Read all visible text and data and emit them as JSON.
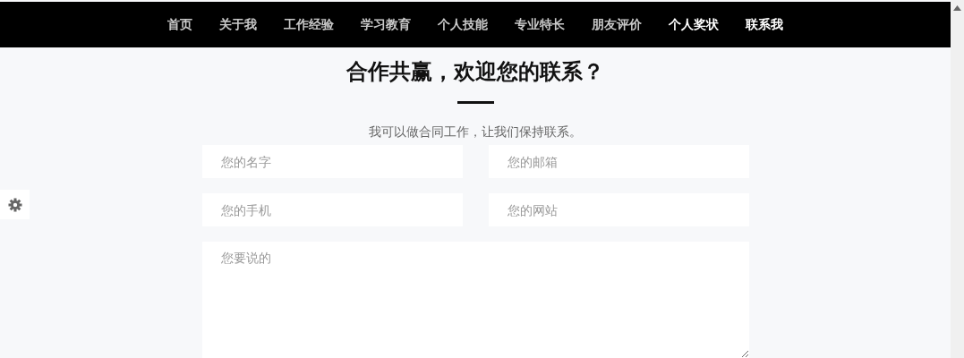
{
  "nav": {
    "items": [
      {
        "label": "首页",
        "selected": false
      },
      {
        "label": "关于我",
        "selected": false
      },
      {
        "label": "工作经验",
        "selected": false
      },
      {
        "label": "学习教育",
        "selected": false
      },
      {
        "label": "个人技能",
        "selected": false
      },
      {
        "label": "专业特长",
        "selected": false
      },
      {
        "label": "朋友评价",
        "selected": false
      },
      {
        "label": "个人奖状",
        "selected": true
      },
      {
        "label": "联系我",
        "selected": true
      }
    ]
  },
  "contact": {
    "title": "合作共赢，欢迎您的联系？",
    "subtitle": "我可以做合同工作，让我们保持联系。",
    "fields": [
      {
        "placeholder": "您的名字"
      },
      {
        "placeholder": "您的邮箱"
      },
      {
        "placeholder": "您的手机"
      },
      {
        "placeholder": "您的网站"
      }
    ],
    "message": {
      "placeholder": "您要说的"
    }
  }
}
